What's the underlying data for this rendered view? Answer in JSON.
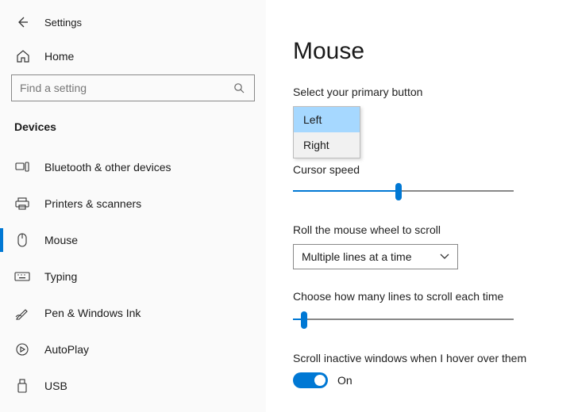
{
  "header": {
    "title": "Settings"
  },
  "home": {
    "label": "Home"
  },
  "search": {
    "placeholder": "Find a setting"
  },
  "section": {
    "label": "Devices"
  },
  "nav": {
    "items": [
      {
        "label": "Bluetooth & other devices"
      },
      {
        "label": "Printers & scanners"
      },
      {
        "label": "Mouse"
      },
      {
        "label": "Typing"
      },
      {
        "label": "Pen & Windows Ink"
      },
      {
        "label": "AutoPlay"
      },
      {
        "label": "USB"
      }
    ]
  },
  "page": {
    "title": "Mouse",
    "primary_button_label": "Select your primary button",
    "primary_options": {
      "left": "Left",
      "right": "Right"
    },
    "cursor_speed_label": "Cursor speed",
    "scroll_mode_label": "Roll the mouse wheel to scroll",
    "scroll_mode_value": "Multiple lines at a time",
    "scroll_lines_label": "Choose how many lines to scroll each time",
    "inactive_label": "Scroll inactive windows when I hover over them",
    "toggle_state": "On"
  }
}
